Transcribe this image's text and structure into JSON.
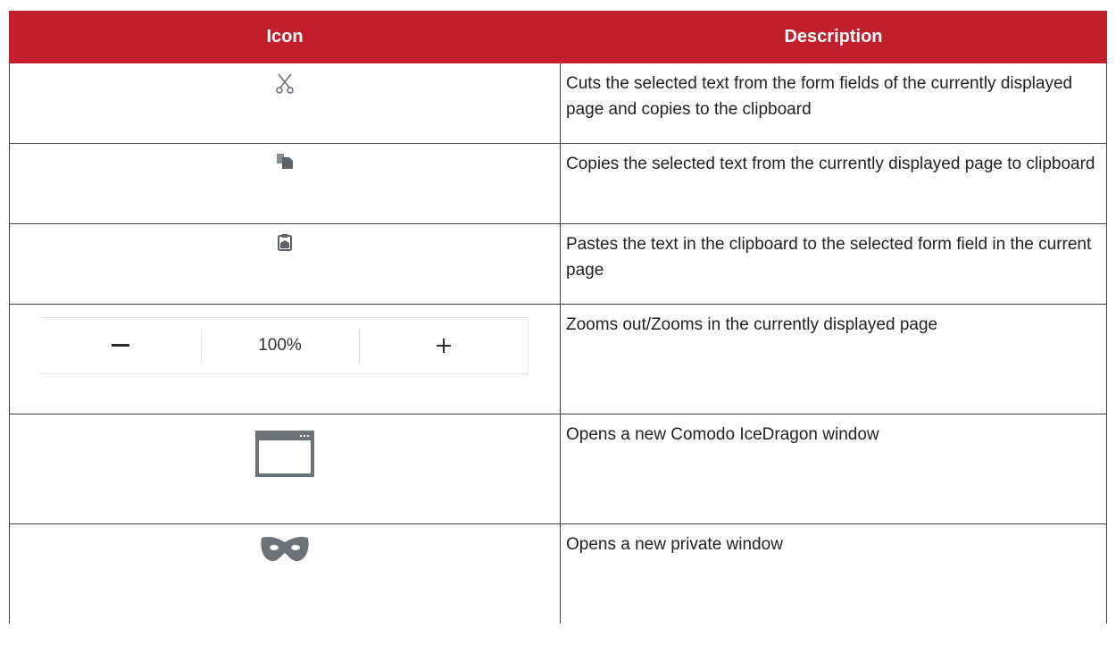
{
  "table": {
    "headers": {
      "icon": "Icon",
      "description": "Description"
    },
    "rows": [
      {
        "icon": "scissors-icon",
        "description": "Cuts the selected text from the form fields of the currently displayed page and copies to the clipboard"
      },
      {
        "icon": "copy-icon",
        "description": "Copies the selected text from the currently displayed page to clipboard"
      },
      {
        "icon": "clipboard-paste-icon",
        "description": "Pastes the text in the clipboard to the selected form field in the current page"
      },
      {
        "icon": "zoom-control",
        "description": "Zooms out/Zooms in the currently displayed page"
      },
      {
        "icon": "new-window-icon",
        "description": "Opens a new Comodo IceDragon window"
      },
      {
        "icon": "private-mask-icon",
        "description": "Opens a new private window"
      }
    ]
  },
  "zoom": {
    "minus": "–",
    "level": "100%",
    "plus": "+"
  },
  "colors": {
    "header_bg": "#c21f2d",
    "icon_gray": "#6d7178"
  }
}
